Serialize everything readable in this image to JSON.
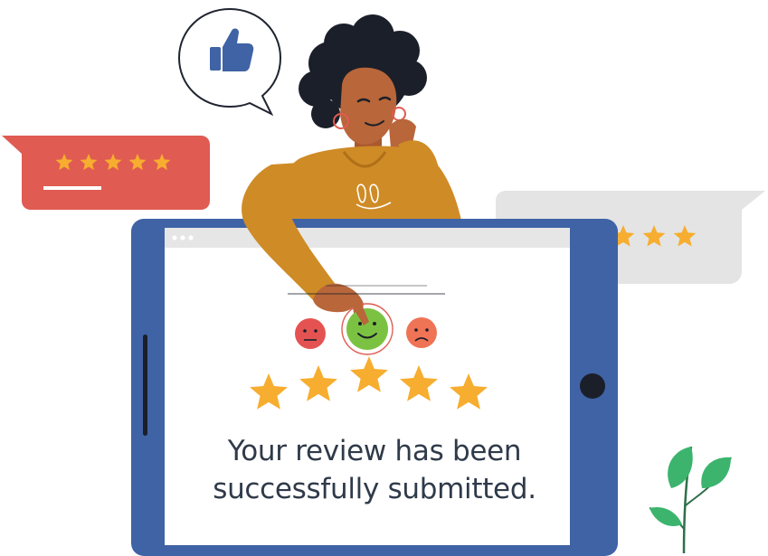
{
  "message": {
    "line1": "Your review has been",
    "line2": "successfully submitted."
  },
  "rating": {
    "stars_filled": 5,
    "stars_total": 5,
    "selected_mood": "happy"
  },
  "mood_options": [
    {
      "name": "neutral-face-icon",
      "color": "#e45352"
    },
    {
      "name": "happy-face-icon",
      "color": "#7cc242"
    },
    {
      "name": "sad-face-icon",
      "color": "#ef7355"
    }
  ],
  "icons": {
    "thumbs_up": "thumbs-up-icon",
    "star": "star-icon",
    "plant": "plant-icon"
  },
  "colors": {
    "tablet_frame": "#3f63a5",
    "star": "#f7ad2f",
    "red_bubble": "#e05b52",
    "grey_bubble": "#e4e4e4",
    "shirt": "#cf8b26",
    "skin": "#b8663a",
    "hair": "#1b1f29",
    "leaf": "#3cb46e",
    "text": "#2f3a4a"
  }
}
